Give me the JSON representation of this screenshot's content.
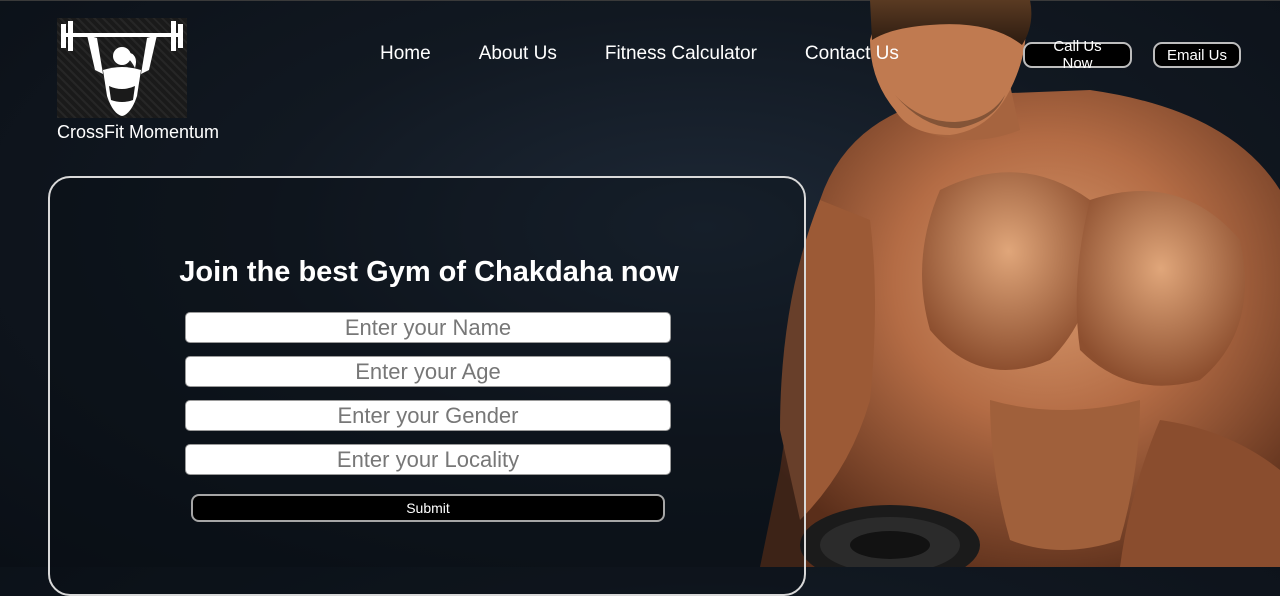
{
  "brand": {
    "name": "CrossFit Momentum",
    "logo_icon": "weightlifter-logo-icon"
  },
  "nav": {
    "items": [
      {
        "label": "Home"
      },
      {
        "label": "About Us"
      },
      {
        "label": "Fitness Calculator"
      },
      {
        "label": "Contact Us"
      }
    ]
  },
  "header_buttons": {
    "call_label": "Call Us Now",
    "email_label": "Email Us"
  },
  "form": {
    "title": "Join the best Gym of Chakdaha now",
    "fields": [
      {
        "placeholder": "Enter your Name"
      },
      {
        "placeholder": "Enter your Age"
      },
      {
        "placeholder": "Enter your Gender"
      },
      {
        "placeholder": "Enter your Locality"
      }
    ],
    "submit_label": "Submit"
  },
  "colors": {
    "background": "#111821",
    "accent_text": "#ffffff",
    "button_bg": "#000000",
    "skin": "#b8704a"
  }
}
